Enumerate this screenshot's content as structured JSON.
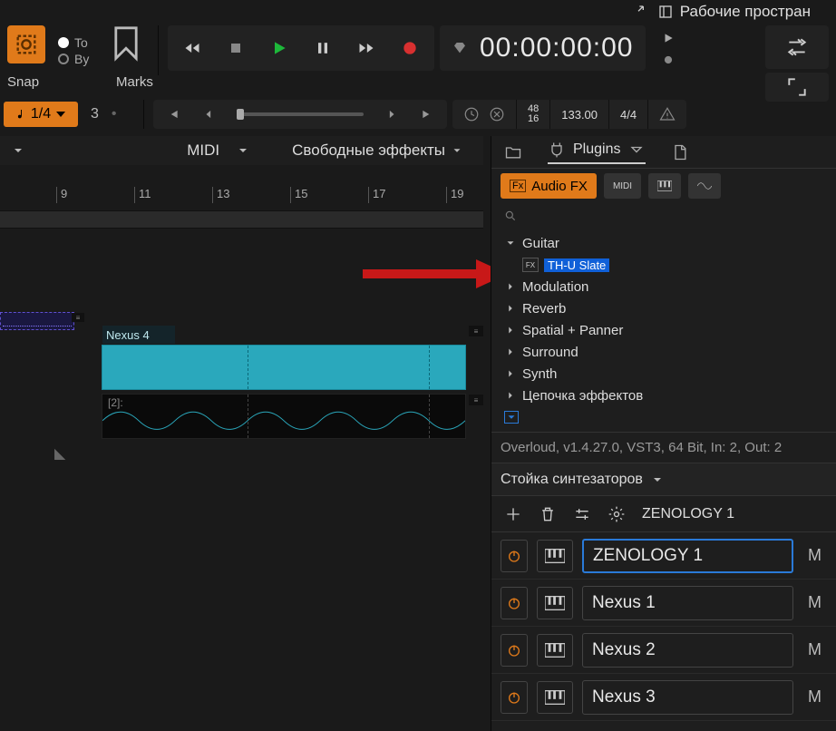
{
  "topbar": {
    "workspaces": "Рабочие простран"
  },
  "snap": {
    "label": "Snap",
    "value": "1/4"
  },
  "toby": {
    "to": "To",
    "by": "By"
  },
  "marks": {
    "label": "Marks",
    "count": "3"
  },
  "timecode": "00:00:00:00",
  "tempo": {
    "beat_top": "48",
    "beat_bot": "16",
    "bpm": "133.00",
    "sig": "4/4"
  },
  "midi_drop": "MIDI",
  "free_fx": "Свободные эффекты",
  "ruler": [
    "9",
    "11",
    "13",
    "15",
    "17",
    "19"
  ],
  "clip_nexus": "Nexus 4",
  "clip_two": "[2]:",
  "browser": {
    "tab_plugins": "Plugins",
    "chip_audio": "Audio FX",
    "tree": {
      "guitar": "Guitar",
      "thu": "TH-U Slate",
      "modulation": "Modulation",
      "reverb": "Reverb",
      "spatial": "Spatial + Panner",
      "surround": "Surround",
      "synth": "Synth",
      "chain": "Цепочка эффектов"
    },
    "info": "Overloud, v1.4.27.0, VST3, 64 Bit, In: 2, Out: 2"
  },
  "rack": {
    "header": "Стойка синтезаторов",
    "selected": "ZENOLOGY 1",
    "items": [
      "ZENOLOGY 1",
      "Nexus 1",
      "Nexus 2",
      "Nexus 3"
    ],
    "m": "M"
  }
}
